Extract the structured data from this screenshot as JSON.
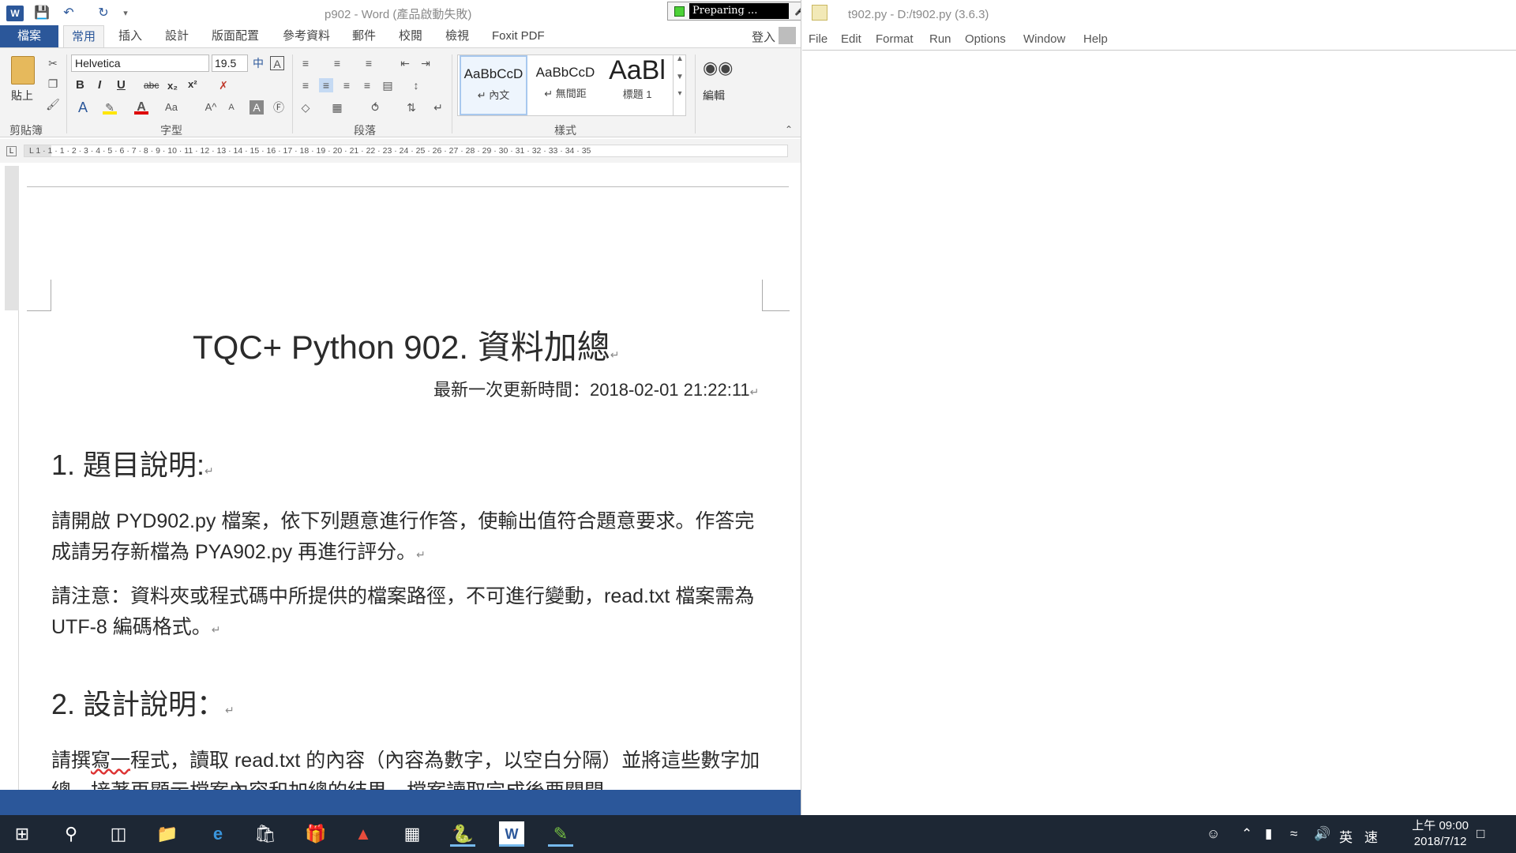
{
  "word": {
    "title": "p902 - Word (產品啟動失敗)",
    "file_tab": "檔案",
    "tabs": [
      "常用",
      "插入",
      "設計",
      "版面配置",
      "參考資料",
      "郵件",
      "校閱",
      "檢視",
      "Foxit PDF"
    ],
    "login": "登入",
    "ribbon": {
      "paste_label": "貼上",
      "font_name": "Helvetica",
      "font_size": "19.5",
      "styles": [
        {
          "preview": "AaBbCcD",
          "name": "↵ 內文"
        },
        {
          "preview": "AaBbCcD",
          "name": "↵ 無間距"
        },
        {
          "preview": "AaBl",
          "name": "標題 1"
        }
      ],
      "edit_label": "編輯",
      "group_labels": [
        "剪貼簿",
        "字型",
        "段落",
        "樣式"
      ]
    },
    "recorder_status": "Preparing ...",
    "ruler_text": "L   1  ·  1  ·  1  ·  2  ·  3  ·  4  ·  5  ·  6  ·  7  ·  8  ·  9  ·  10  ·  11  ·  12  ·  13  ·  14  ·  15  ·  16  ·  17  ·  18  ·  19  ·  20  ·  21  ·  22  ·  23  ·  24  ·  25  ·  26  ·  27  ·  28  ·  29  ·  30  ·  31  ·  32  ·  33  ·  34  ·  35",
    "document": {
      "title": "TQC+ Python 902.  資料加總",
      "updated": "最新一次更新時間：2018-02-01 21:22:11",
      "h1": "1.  題目說明:",
      "p1": "請開啟 PYD902.py 檔案，依下列題意進行作答，使輸出值符合題意要求。作答完成請另存新檔為 PYA902.py 再進行評分。",
      "p2": "請注意：資料夾或程式碼中所提供的檔案路徑，不可進行變動，read.txt 檔案需為 UTF-8 編碼格式。",
      "h2": "2.  設計說明：",
      "p3_a": "請撰",
      "p3_red": "寫一",
      "p3_b": "程式，讀取 read.txt 的內容（內容為數字，以空白分隔）並將這些數字加總，接著再顯示檔案內容和加總的結果，檔案讀取完成後要關閉。"
    }
  },
  "idle": {
    "title": "t902.py - D:/t902.py (3.6.3)",
    "menus": [
      "File",
      "Edit",
      "Format",
      "Run",
      "Options",
      "Window",
      "Help"
    ]
  },
  "taskbar": {
    "ime": "英",
    "ime2": "速",
    "time": "上午 09:00",
    "date": "2018/7/12"
  },
  "colors": {
    "word_blue": "#2b579a",
    "taskbar_bg": "#1d2734"
  }
}
